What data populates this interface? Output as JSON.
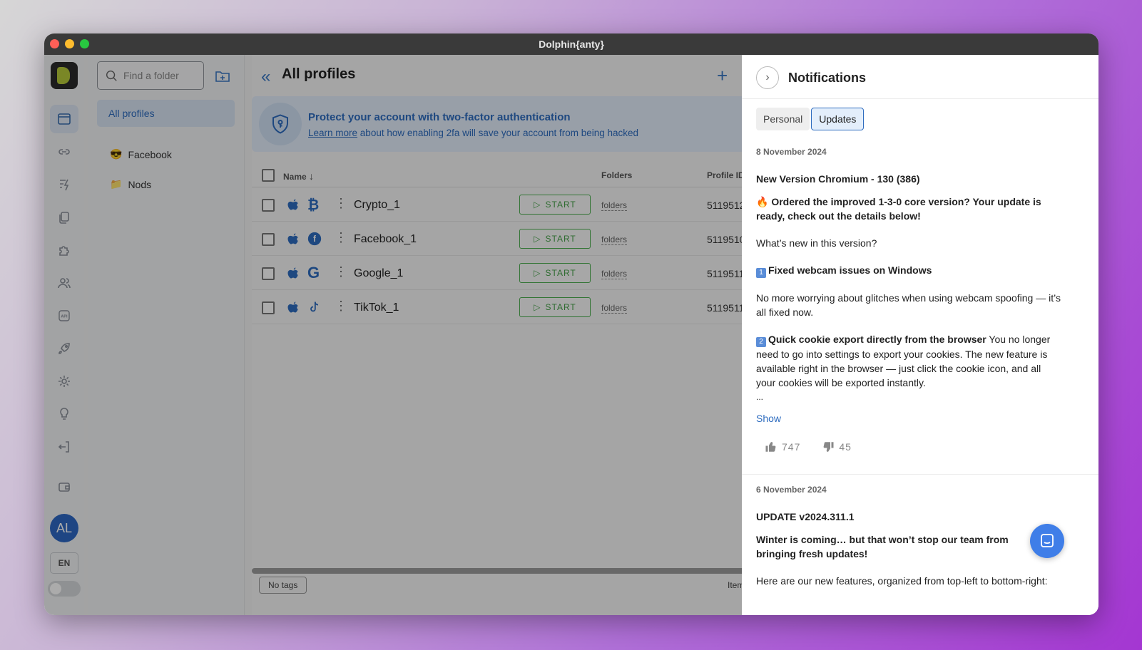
{
  "window": {
    "title": "Dolphin{anty}"
  },
  "rail": {
    "icons": [
      "profiles-icon",
      "link-icon",
      "automation-icon",
      "copy-icon",
      "extensions-icon",
      "users-icon",
      "api-icon",
      "rocket-icon",
      "settings-icon",
      "lightbulb-icon",
      "logout-icon",
      "wallet-icon"
    ],
    "avatar_initials": "AL",
    "language": "EN"
  },
  "folders": {
    "search_placeholder": "Find a folder",
    "all_label": "All profiles",
    "items": [
      {
        "emoji": "😎",
        "label": "Facebook"
      },
      {
        "emoji": "📁",
        "label": "Nods"
      }
    ]
  },
  "main": {
    "title": "All profiles",
    "banner": {
      "title": "Protect your account with two-factor authentication",
      "link": "Learn more",
      "text": " about how enabling 2fa will save your account from being hacked"
    },
    "columns": {
      "name": "Name",
      "folders": "Folders",
      "profile_id": "Profile ID"
    },
    "rows": [
      {
        "name": "Crypto_1",
        "brand_icon": "bitcoin-icon",
        "start": "START",
        "folders": "folders",
        "id": "5119512"
      },
      {
        "name": "Facebook_1",
        "brand_icon": "facebook-icon",
        "start": "START",
        "folders": "folders",
        "id": "5119510"
      },
      {
        "name": "Google_1",
        "brand_icon": "google-icon",
        "start": "START",
        "folders": "folders",
        "id": "5119511"
      },
      {
        "name": "TikTok_1",
        "brand_icon": "tiktok-icon",
        "start": "START",
        "folders": "folders",
        "id": "5119511"
      }
    ],
    "no_tags": "No tags",
    "items_label": "Item"
  },
  "notifications": {
    "title": "Notifications",
    "tabs": [
      "Personal",
      "Updates"
    ],
    "active_tab": "Updates",
    "post1": {
      "date": "8 November 2024",
      "title": "New Version Chromium - 130 (386)",
      "intro": "Ordered the improved 1-3-0 core version? Your update is ready, check out the details below!",
      "question": "What’s new in this version?",
      "point1_title": "Fixed webcam issues on Windows",
      "point1_text": "No more worrying about glitches when using webcam spoofing — it’s all fixed now.",
      "point2_title": "Quick cookie export directly from the browser",
      "point2_text": " You no longer need to go into settings to export your cookies. The new feature is available right in the browser — just click the cookie icon, and all your cookies will be exported instantly.",
      "ellipsis": "...",
      "show": "Show",
      "likes": "747",
      "dislikes": "45"
    },
    "post2": {
      "date": "6 November 2024",
      "title": "UPDATE v2024.311.1",
      "intro": "Winter is coming… but that won’t stop our team from bringing fresh updates!",
      "text": "Here are our new features, organized from top-left to bottom-right:"
    }
  },
  "colors": {
    "accent": "#2e6cbf",
    "start_green": "#43a047",
    "bg_gradient_end": "#a436d2"
  }
}
